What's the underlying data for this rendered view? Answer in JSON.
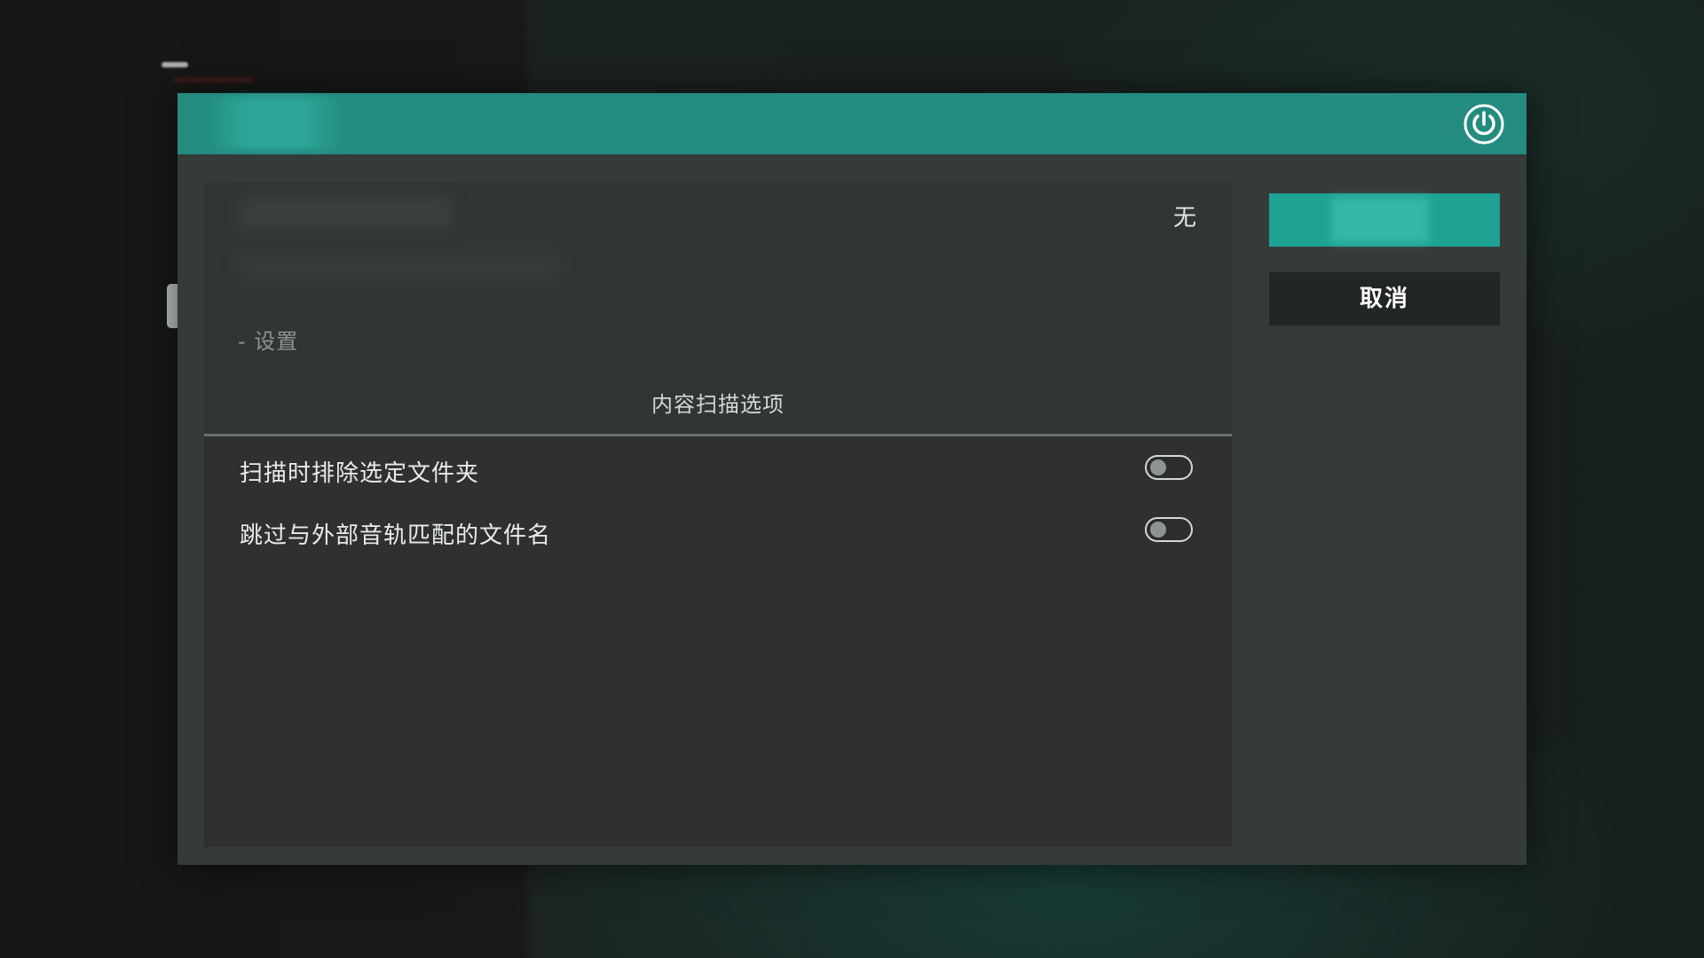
{
  "dialog": {
    "header": {
      "title": "",
      "power_icon": "power-icon",
      "accent_color": "#248b80"
    },
    "panel": {
      "value": "无",
      "breadcrumb": "- 设置",
      "section_title": "内容扫描选项"
    },
    "options": [
      {
        "label": "扫描时排除选定文件夹",
        "enabled": false
      },
      {
        "label": "跳过与外部音轨匹配的文件名",
        "enabled": false
      }
    ],
    "buttons": {
      "primary_label": "",
      "cancel_label": "取消"
    }
  }
}
